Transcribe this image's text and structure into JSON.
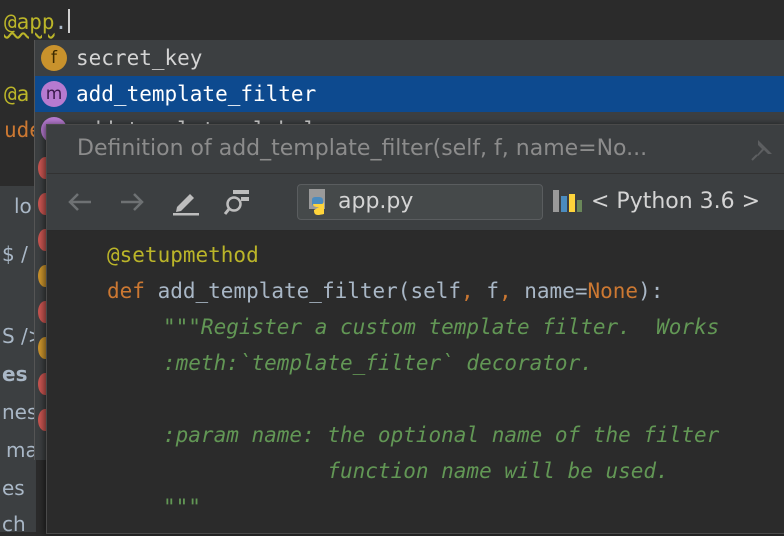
{
  "editor": {
    "line1_at": "@app",
    "line1_dot": ".",
    "frag_at2": "@a",
    "frag_ude": "ude"
  },
  "left_panel": {
    "items": [
      "lo",
      "$ /",
      "S />",
      "es",
      "nes",
      "ma",
      "es",
      "ch"
    ]
  },
  "completion": {
    "items": [
      {
        "badge": "f",
        "label": "secret_key"
      },
      {
        "badge": "m",
        "label": "add_template_filter"
      },
      {
        "badge": "m",
        "label": "add_template_global"
      }
    ]
  },
  "definition": {
    "title": "Definition of add_template_filter(self, f, name=No...",
    "file": "app.py",
    "sdk": "< Python 3.6 >",
    "code": {
      "decorator": "@setupmethod",
      "def_kw": "def",
      "signature": " add_template_filter(self",
      "comma1": ",",
      "arg_f": " f",
      "comma2": ",",
      "arg_name": " name=",
      "none_kw": "None",
      "sig_end": "):",
      "doc1": "\"\"\"Register a custom template filter.  Works",
      "doc2": ":meth:`template_filter` decorator.",
      "doc3": ":param name: the optional name of the filter",
      "doc4": "             function name will be used.",
      "doc5": "\"\"\""
    }
  },
  "colors": {
    "selection": "#0d4a8f",
    "badge_field": "#c9922c",
    "badge_method": "#b67ad0",
    "docstring": "#629755",
    "keyword": "#cc7832",
    "decorator": "#bbb529"
  },
  "icons": [
    "back-arrow-icon",
    "forward-arrow-icon",
    "edit-pencil-icon",
    "find-usages-icon",
    "python-file-icon",
    "python-sdk-icon",
    "pin-icon"
  ]
}
